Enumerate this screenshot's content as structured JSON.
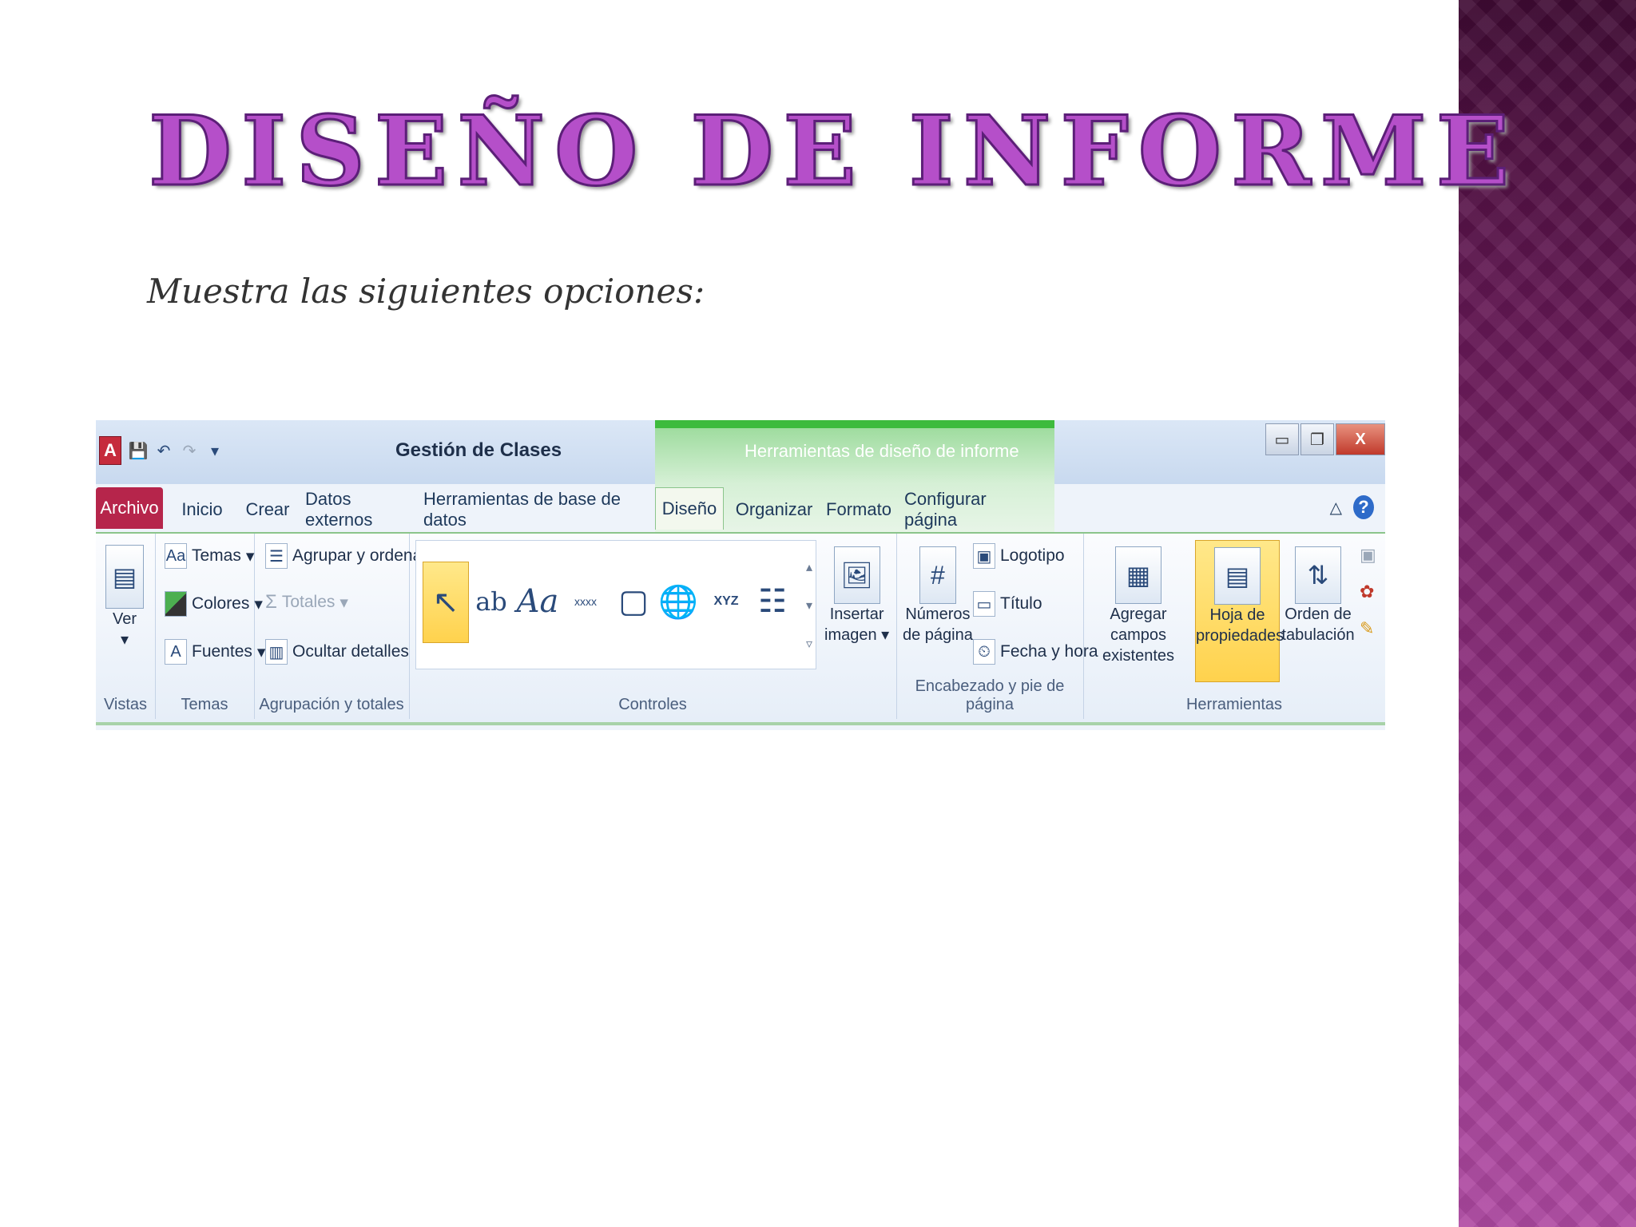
{
  "slide": {
    "title": "DISEÑO DE INFORME",
    "subtitle": "Muestra las siguientes opciones:"
  },
  "ribbon": {
    "app_title": "Gestión de Clases",
    "contextual_title": "Herramientas de diseño de informe",
    "qat": {
      "app_icon": "A",
      "save_icon": "save-icon",
      "undo_icon": "undo-icon",
      "redo_icon": "redo-icon",
      "customize_icon": "customize-icon"
    },
    "window_buttons": {
      "minimize": "▭",
      "restore": "❐",
      "close": "X"
    },
    "tabs": [
      {
        "label": "Archivo"
      },
      {
        "label": "Inicio"
      },
      {
        "label": "Crear"
      },
      {
        "label": "Datos externos"
      },
      {
        "label": "Herramientas de base de datos"
      },
      {
        "label": "Diseño"
      },
      {
        "label": "Organizar"
      },
      {
        "label": "Formato"
      },
      {
        "label": "Configurar página"
      }
    ],
    "help": "?",
    "groups": {
      "vistas": {
        "label": "Vistas",
        "ver": "Ver"
      },
      "temas": {
        "label": "Temas",
        "temas": "Temas",
        "colores": "Colores",
        "fuentes": "Fuentes"
      },
      "agrupacion": {
        "label": "Agrupación y totales",
        "agrupar": "Agrupar y ordenar",
        "totales": "Totales",
        "ocultar": "Ocultar detalles"
      },
      "controles": {
        "label": "Controles",
        "insertar_imagen_1": "Insertar",
        "insertar_imagen_2": "imagen"
      },
      "encabezado": {
        "label": "Encabezado y pie de página",
        "numeros_1": "Números",
        "numeros_2": "de página",
        "logotipo": "Logotipo",
        "titulo": "Título",
        "fecha": "Fecha y hora"
      },
      "herramientas": {
        "label": "Herramientas",
        "agregar_1": "Agregar campos",
        "agregar_2": "existentes",
        "hoja_1": "Hoja de",
        "hoja_2": "propiedades",
        "orden_1": "Orden de",
        "orden_2": "tabulación"
      }
    },
    "controls_text": {
      "textbox": "ab",
      "label": "Aa",
      "button": "xxxx",
      "xyz": "XYZ"
    }
  }
}
